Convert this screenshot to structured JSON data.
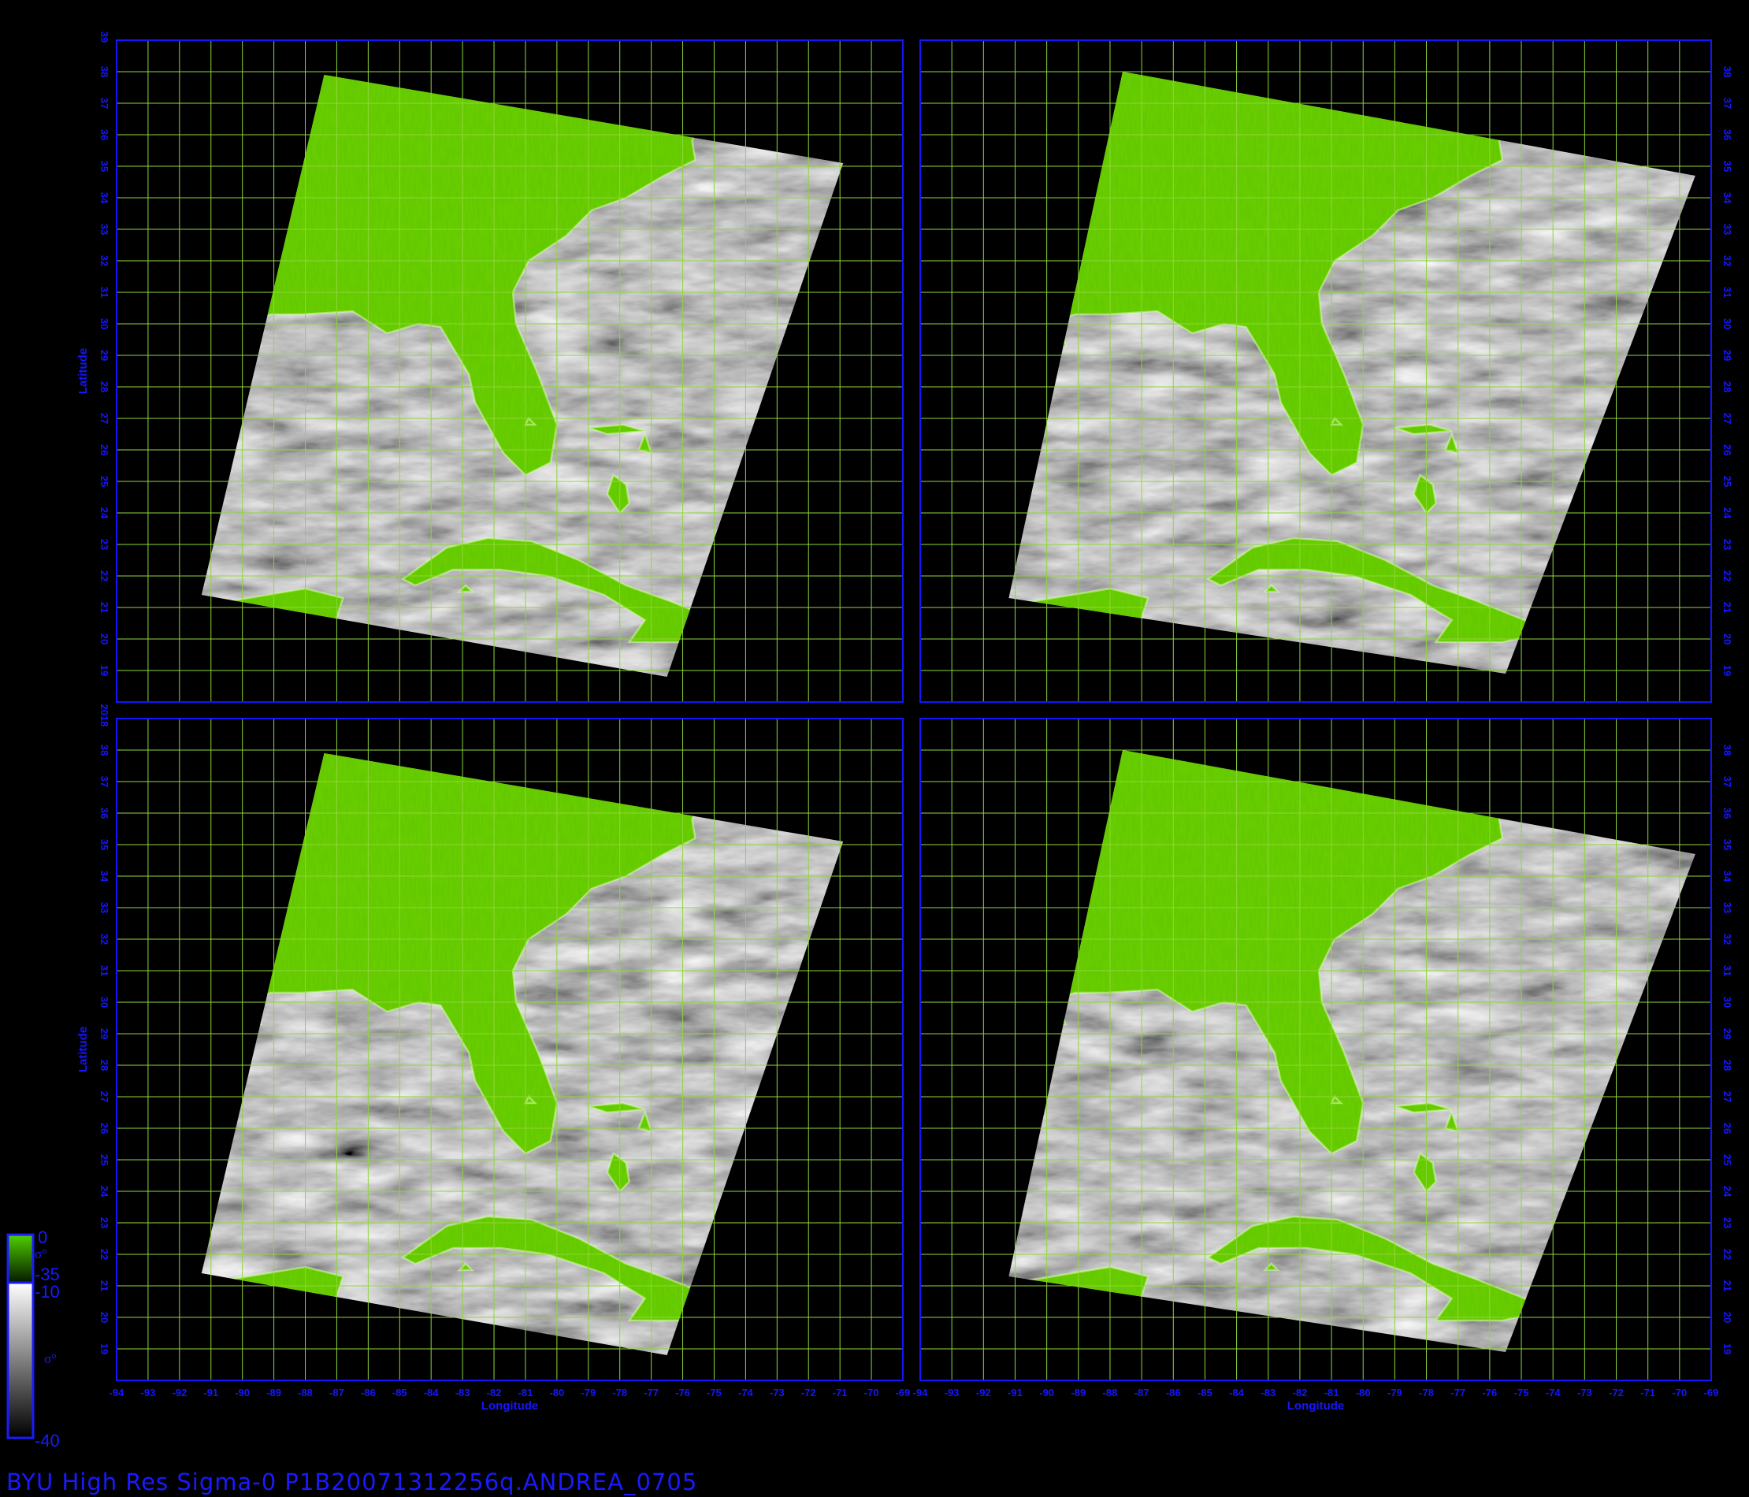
{
  "footer_title": "BYU  High  Res  Sigma-0  P1B20071312256q.ANDREA_0705",
  "axes": {
    "xlabel": "Longitude",
    "ylabel": "Latitude",
    "lon_ticks": [
      "-94",
      "-93",
      "-92",
      "-91",
      "-90",
      "-89",
      "-88",
      "-87",
      "-86",
      "-85",
      "-84",
      "-83",
      "-82",
      "-81",
      "-80",
      "-79",
      "-78",
      "-77",
      "-76",
      "-75",
      "-74",
      "-73",
      "-72",
      "-71",
      "-70",
      "-69"
    ],
    "lat_ticks": [
      "19",
      "20",
      "21",
      "22",
      "23",
      "24",
      "25",
      "26",
      "27",
      "28",
      "29",
      "30",
      "31",
      "32",
      "33",
      "34",
      "35",
      "36",
      "37",
      "38"
    ],
    "lat_bottom_label": "18",
    "lat_top_label": "39",
    "shared_corner_label": "2018"
  },
  "colorbar": {
    "land": {
      "top_label": "0",
      "bottom_label": "-35",
      "symbol": "σ°",
      "color": "#4caf00"
    },
    "ocean": {
      "top_label": "-10",
      "bottom_label": "-40",
      "symbol": "σ°"
    }
  },
  "colors": {
    "background": "#000000",
    "frame": "#1414ff",
    "grid": "#8fd63a",
    "land": "#5fc800",
    "text": "#1a1aff"
  },
  "panels": [
    {
      "id": "top-left"
    },
    {
      "id": "top-right"
    },
    {
      "id": "bottom-left"
    },
    {
      "id": "bottom-right"
    }
  ]
}
